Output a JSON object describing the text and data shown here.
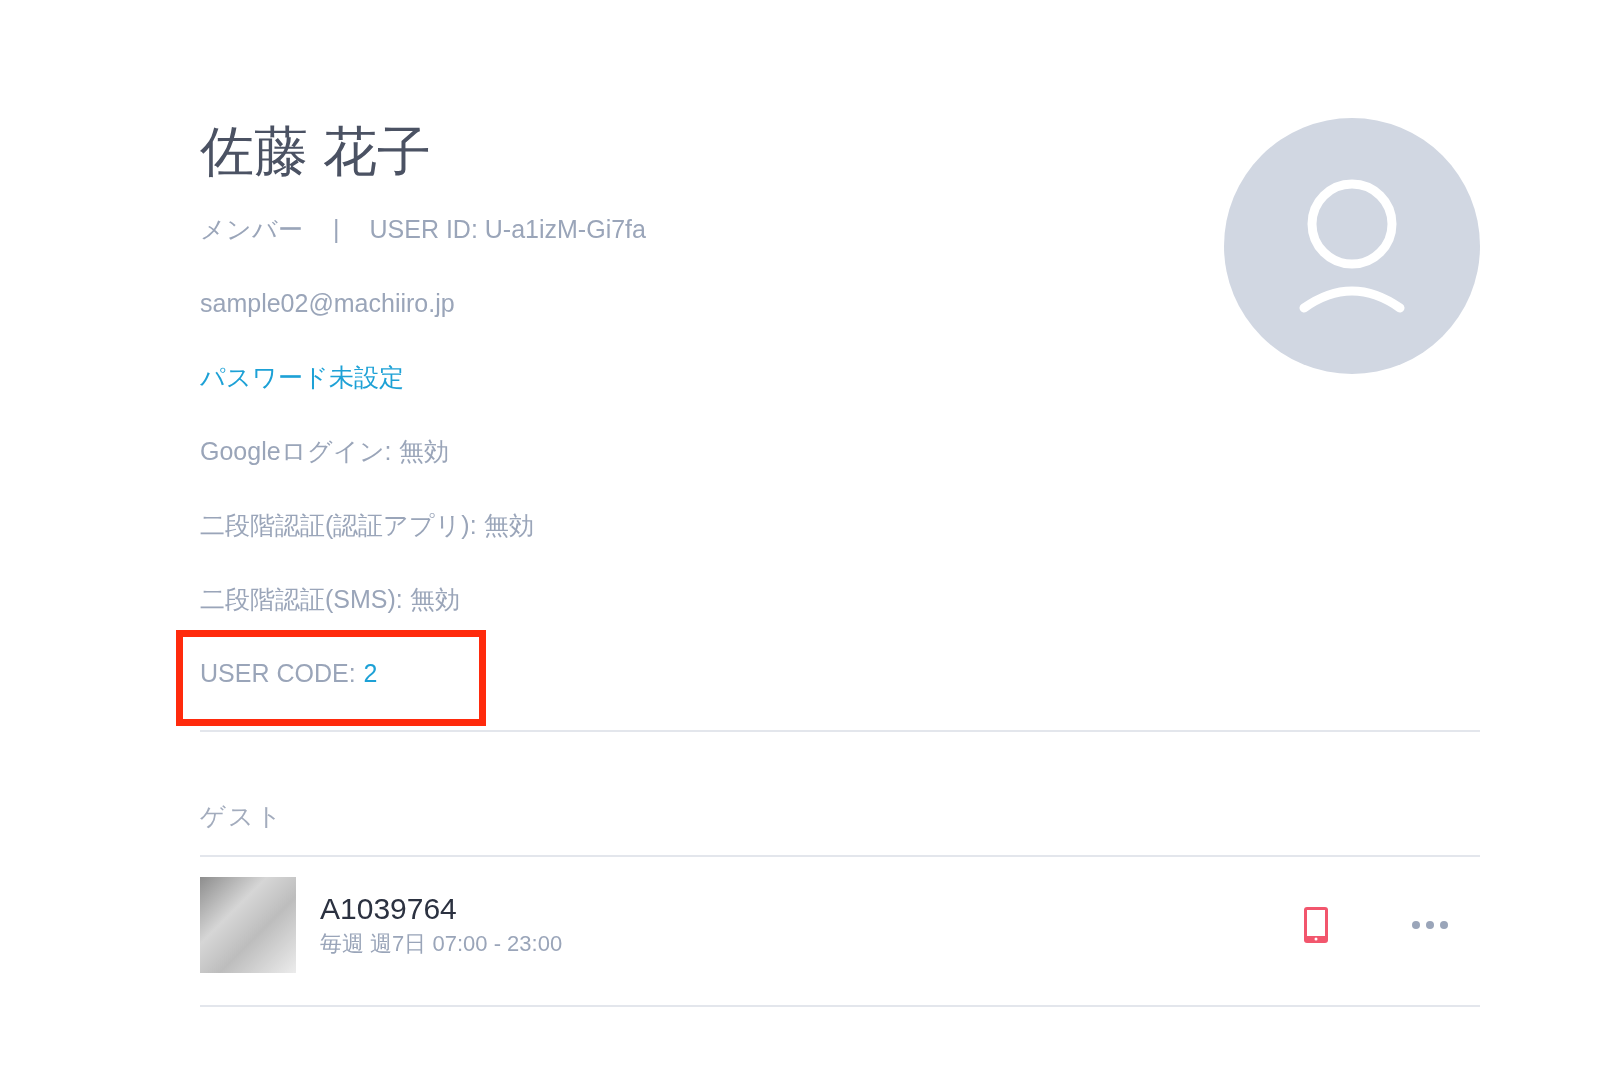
{
  "user": {
    "name": "佐藤 花子",
    "role": "メンバー",
    "separator": "|",
    "user_id": "USER ID: U-a1izM-Gi7fa",
    "email": "sample02@machiiro.jp",
    "password_status": "パスワード未設定",
    "google_login": "Googleログイン: 無効",
    "two_factor_app": "二段階認証(認証アプリ): 無効",
    "two_factor_sms": "二段階認証(SMS): 無効",
    "user_code_label": "USER CODE:",
    "user_code_value": "2",
    "user_code_highlighted": true
  },
  "guests": {
    "heading": "ゲスト",
    "items": [
      {
        "title": "A1039764",
        "schedule": "毎週 週7日 07:00 - 23:00"
      }
    ]
  }
}
